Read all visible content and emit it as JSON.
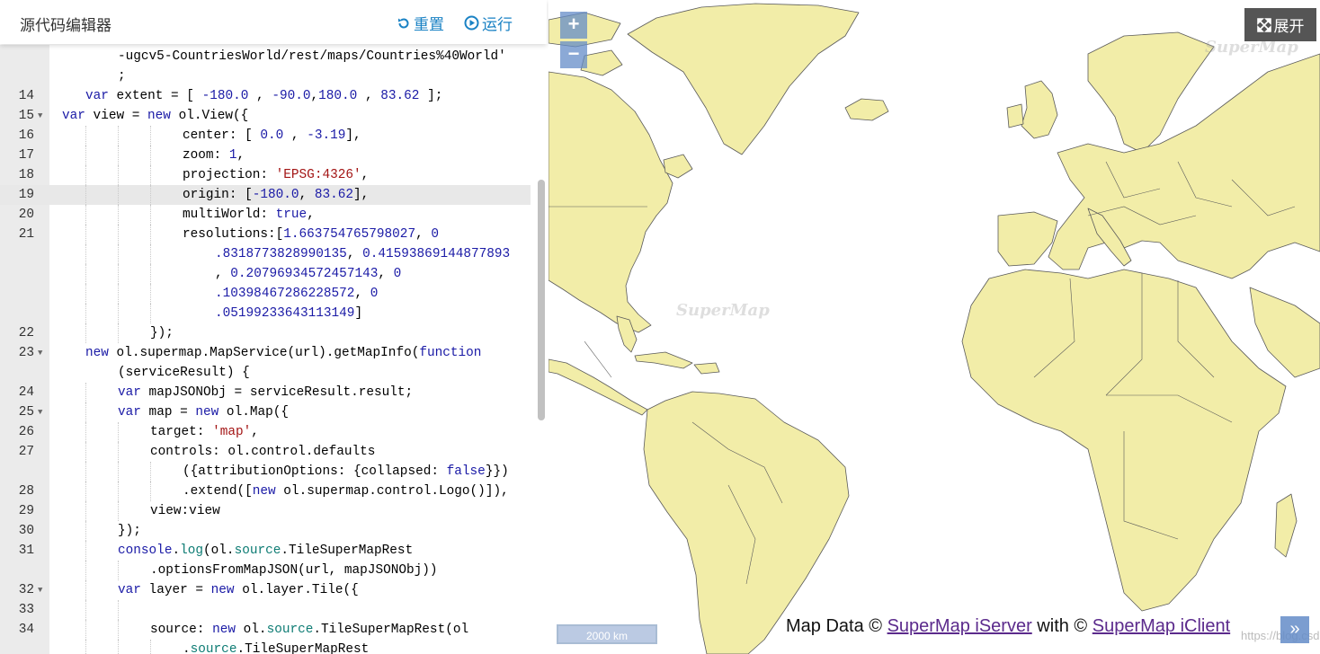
{
  "editor": {
    "title": "源代码编辑器",
    "reset_label": "重置",
    "run_label": "运行"
  },
  "code_lines": [
    {
      "num": "",
      "fold": false,
      "guides": [],
      "indent": 131,
      "html": "-ugcv5-CountriesWorld/rest/maps/Countries%40World'"
    },
    {
      "num": "",
      "fold": false,
      "guides": [],
      "indent": 131,
      "html": ";"
    },
    {
      "num": "14",
      "fold": false,
      "guides": [],
      "indent": 95,
      "html": "<span class='kw'>var</span> extent = [ <span class='num'>-180.0</span> , <span class='num'>-90.0</span>,<span class='num'>180.0</span> , <span class='num'>83.62</span> ];"
    },
    {
      "num": "15",
      "fold": true,
      "guides": [],
      "indent": 69,
      "html": "<span class='kw'>var</span> view = <span class='kw'>new</span> ol.View({"
    },
    {
      "num": "16",
      "fold": false,
      "guides": [
        95,
        131,
        167
      ],
      "indent": 203,
      "html": "center: [ <span class='num'>0.0</span> , <span class='num'>-3.19</span>],"
    },
    {
      "num": "17",
      "fold": false,
      "guides": [
        95,
        131,
        167
      ],
      "indent": 203,
      "html": "zoom: <span class='num'>1</span>,"
    },
    {
      "num": "18",
      "fold": false,
      "guides": [
        95,
        131,
        167
      ],
      "indent": 203,
      "html": "projection: <span class='str'>'EPSG:4326'</span>,"
    },
    {
      "num": "19",
      "fold": false,
      "active": true,
      "guides": [
        95,
        131,
        167
      ],
      "indent": 203,
      "html": "origin: [<span class='num'>-180.0</span>, <span class='num'>83.62</span>],"
    },
    {
      "num": "20",
      "fold": false,
      "guides": [
        95,
        131,
        167
      ],
      "indent": 203,
      "html": "multiWorld: <span class='kw'>true</span>,"
    },
    {
      "num": "21",
      "fold": false,
      "guides": [
        95,
        131,
        167
      ],
      "indent": 203,
      "html": "resolutions:[<span class='num'>1.663754765798027</span>, <span class='num'>0</span>"
    },
    {
      "num": "",
      "fold": false,
      "guides": [
        95,
        131,
        167
      ],
      "indent": 239,
      "html": "<span class='num'>.8318773828990135</span>, <span class='num'>0.41593869144877893</span>"
    },
    {
      "num": "",
      "fold": false,
      "guides": [
        95,
        131,
        167
      ],
      "indent": 239,
      "html": ", <span class='num'>0.20796934572457143</span>, <span class='num'>0</span>"
    },
    {
      "num": "",
      "fold": false,
      "guides": [
        95,
        131,
        167
      ],
      "indent": 239,
      "html": "<span class='num'>.10398467286228572</span>, <span class='num'>0</span>"
    },
    {
      "num": "",
      "fold": false,
      "guides": [
        95,
        131,
        167
      ],
      "indent": 239,
      "html": "<span class='num'>.05199233643113149</span>]"
    },
    {
      "num": "22",
      "fold": false,
      "guides": [
        95,
        131
      ],
      "indent": 167,
      "html": "});"
    },
    {
      "num": "23",
      "fold": true,
      "guides": [],
      "indent": 95,
      "html": "<span class='kw'>new</span> ol.supermap.MapService(url).getMapInfo(<span class='kw'>function</span>"
    },
    {
      "num": "",
      "fold": false,
      "guides": [],
      "indent": 131,
      "html": "(serviceResult) {"
    },
    {
      "num": "24",
      "fold": false,
      "guides": [
        95
      ],
      "indent": 131,
      "html": "<span class='kw'>var</span> mapJSONObj = serviceResult.result;"
    },
    {
      "num": "25",
      "fold": true,
      "guides": [
        95
      ],
      "indent": 131,
      "html": "<span class='kw'>var</span> map = <span class='kw'>new</span> ol.Map({"
    },
    {
      "num": "26",
      "fold": false,
      "guides": [
        95,
        131
      ],
      "indent": 167,
      "html": "target: <span class='str'>'map'</span>,"
    },
    {
      "num": "27",
      "fold": false,
      "guides": [
        95,
        131
      ],
      "indent": 167,
      "html": "controls: ol.control.defaults"
    },
    {
      "num": "",
      "fold": false,
      "guides": [
        95,
        131,
        167
      ],
      "indent": 203,
      "html": "({attributionOptions: {collapsed: <span class='kw'>false</span>}})"
    },
    {
      "num": "28",
      "fold": false,
      "guides": [
        95,
        131,
        167
      ],
      "indent": 203,
      "html": ".extend([<span class='kw'>new</span> ol.supermap.control.Logo()]),"
    },
    {
      "num": "29",
      "fold": false,
      "guides": [
        95,
        131
      ],
      "indent": 167,
      "html": "view:view"
    },
    {
      "num": "30",
      "fold": false,
      "guides": [
        95
      ],
      "indent": 131,
      "html": "});"
    },
    {
      "num": "31",
      "fold": false,
      "guides": [
        95
      ],
      "indent": 131,
      "html": "<span class='kw'>console</span>.<span class='prop'>log</span>(ol.<span class='prop'>source</span>.TileSuperMapRest"
    },
    {
      "num": "",
      "fold": false,
      "guides": [
        95,
        131
      ],
      "indent": 167,
      "html": ".optionsFromMapJSON(url, mapJSONObj))"
    },
    {
      "num": "32",
      "fold": true,
      "guides": [
        95
      ],
      "indent": 131,
      "html": "<span class='kw'>var</span> layer = <span class='kw'>new</span> ol.layer.Tile({"
    },
    {
      "num": "33",
      "fold": false,
      "guides": [
        95,
        131
      ],
      "indent": 167,
      "html": ""
    },
    {
      "num": "34",
      "fold": false,
      "guides": [
        95,
        131
      ],
      "indent": 167,
      "html": "source: <span class='kw'>new</span> ol.<span class='prop'>source</span>.TileSuperMapRest(ol"
    },
    {
      "num": "",
      "fold": false,
      "guides": [
        95,
        131,
        167
      ],
      "indent": 203,
      "html": ".<span class='prop'>source</span>.TileSuperMapRest"
    }
  ],
  "map": {
    "zoom_in": "+",
    "zoom_out": "−",
    "expand_label": "展开",
    "scale": "2000 km",
    "attr_prefix": "Map Data © ",
    "attr_link1": "SuperMap iServer",
    "attr_mid": " with © ",
    "attr_link2": "SuperMap iClient",
    "attr_toggle": "»",
    "watermark": "SuperMap",
    "csdn": "https://blog.csdn.net/supermapsupport",
    "land_color": "#f2eda8",
    "border_color": "#5a5a5a"
  }
}
